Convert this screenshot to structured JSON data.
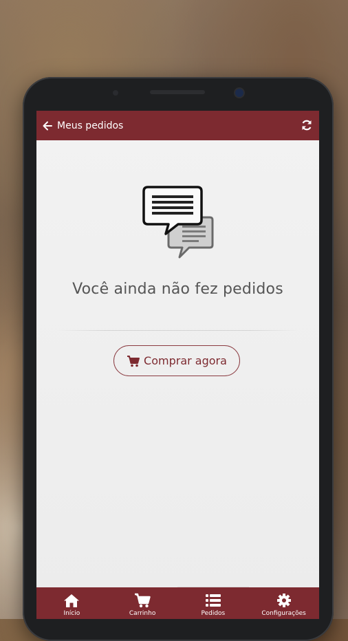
{
  "header": {
    "title": "Meus pedidos",
    "back_icon": "arrow-left-icon",
    "refresh_icon": "refresh-icon"
  },
  "empty_state": {
    "icon": "chat-bubbles-icon",
    "message": "Você ainda não fez pedidos",
    "button_label": "Comprar agora",
    "button_icon": "cart-icon"
  },
  "bottom_nav": {
    "items": [
      {
        "label": "Início",
        "icon": "home-icon"
      },
      {
        "label": "Carrinho",
        "icon": "cart-icon"
      },
      {
        "label": "Pedidos",
        "icon": "list-icon"
      },
      {
        "label": "Configurações",
        "icon": "gear-icon"
      }
    ]
  },
  "colors": {
    "primary": "#7d2a30",
    "background": "#f0f0f0",
    "text": "#555555"
  }
}
